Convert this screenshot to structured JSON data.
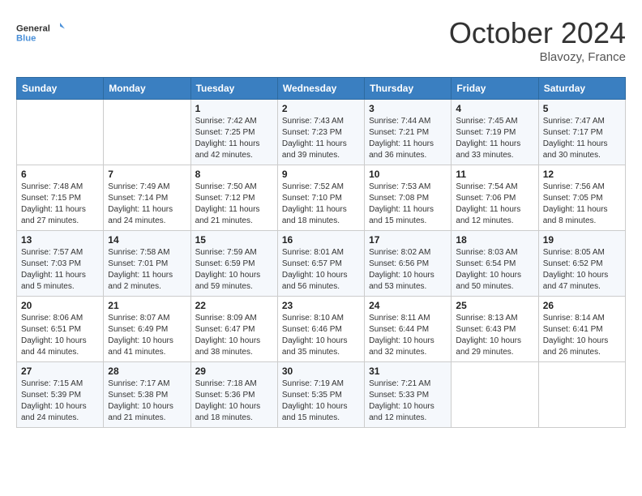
{
  "header": {
    "logo_line1": "General",
    "logo_line2": "Blue",
    "month": "October 2024",
    "location": "Blavozy, France"
  },
  "weekdays": [
    "Sunday",
    "Monday",
    "Tuesday",
    "Wednesday",
    "Thursday",
    "Friday",
    "Saturday"
  ],
  "weeks": [
    [
      {
        "day": "",
        "sunrise": "",
        "sunset": "",
        "daylight": ""
      },
      {
        "day": "",
        "sunrise": "",
        "sunset": "",
        "daylight": ""
      },
      {
        "day": "1",
        "sunrise": "Sunrise: 7:42 AM",
        "sunset": "Sunset: 7:25 PM",
        "daylight": "Daylight: 11 hours and 42 minutes."
      },
      {
        "day": "2",
        "sunrise": "Sunrise: 7:43 AM",
        "sunset": "Sunset: 7:23 PM",
        "daylight": "Daylight: 11 hours and 39 minutes."
      },
      {
        "day": "3",
        "sunrise": "Sunrise: 7:44 AM",
        "sunset": "Sunset: 7:21 PM",
        "daylight": "Daylight: 11 hours and 36 minutes."
      },
      {
        "day": "4",
        "sunrise": "Sunrise: 7:45 AM",
        "sunset": "Sunset: 7:19 PM",
        "daylight": "Daylight: 11 hours and 33 minutes."
      },
      {
        "day": "5",
        "sunrise": "Sunrise: 7:47 AM",
        "sunset": "Sunset: 7:17 PM",
        "daylight": "Daylight: 11 hours and 30 minutes."
      }
    ],
    [
      {
        "day": "6",
        "sunrise": "Sunrise: 7:48 AM",
        "sunset": "Sunset: 7:15 PM",
        "daylight": "Daylight: 11 hours and 27 minutes."
      },
      {
        "day": "7",
        "sunrise": "Sunrise: 7:49 AM",
        "sunset": "Sunset: 7:14 PM",
        "daylight": "Daylight: 11 hours and 24 minutes."
      },
      {
        "day": "8",
        "sunrise": "Sunrise: 7:50 AM",
        "sunset": "Sunset: 7:12 PM",
        "daylight": "Daylight: 11 hours and 21 minutes."
      },
      {
        "day": "9",
        "sunrise": "Sunrise: 7:52 AM",
        "sunset": "Sunset: 7:10 PM",
        "daylight": "Daylight: 11 hours and 18 minutes."
      },
      {
        "day": "10",
        "sunrise": "Sunrise: 7:53 AM",
        "sunset": "Sunset: 7:08 PM",
        "daylight": "Daylight: 11 hours and 15 minutes."
      },
      {
        "day": "11",
        "sunrise": "Sunrise: 7:54 AM",
        "sunset": "Sunset: 7:06 PM",
        "daylight": "Daylight: 11 hours and 12 minutes."
      },
      {
        "day": "12",
        "sunrise": "Sunrise: 7:56 AM",
        "sunset": "Sunset: 7:05 PM",
        "daylight": "Daylight: 11 hours and 8 minutes."
      }
    ],
    [
      {
        "day": "13",
        "sunrise": "Sunrise: 7:57 AM",
        "sunset": "Sunset: 7:03 PM",
        "daylight": "Daylight: 11 hours and 5 minutes."
      },
      {
        "day": "14",
        "sunrise": "Sunrise: 7:58 AM",
        "sunset": "Sunset: 7:01 PM",
        "daylight": "Daylight: 11 hours and 2 minutes."
      },
      {
        "day": "15",
        "sunrise": "Sunrise: 7:59 AM",
        "sunset": "Sunset: 6:59 PM",
        "daylight": "Daylight: 10 hours and 59 minutes."
      },
      {
        "day": "16",
        "sunrise": "Sunrise: 8:01 AM",
        "sunset": "Sunset: 6:57 PM",
        "daylight": "Daylight: 10 hours and 56 minutes."
      },
      {
        "day": "17",
        "sunrise": "Sunrise: 8:02 AM",
        "sunset": "Sunset: 6:56 PM",
        "daylight": "Daylight: 10 hours and 53 minutes."
      },
      {
        "day": "18",
        "sunrise": "Sunrise: 8:03 AM",
        "sunset": "Sunset: 6:54 PM",
        "daylight": "Daylight: 10 hours and 50 minutes."
      },
      {
        "day": "19",
        "sunrise": "Sunrise: 8:05 AM",
        "sunset": "Sunset: 6:52 PM",
        "daylight": "Daylight: 10 hours and 47 minutes."
      }
    ],
    [
      {
        "day": "20",
        "sunrise": "Sunrise: 8:06 AM",
        "sunset": "Sunset: 6:51 PM",
        "daylight": "Daylight: 10 hours and 44 minutes."
      },
      {
        "day": "21",
        "sunrise": "Sunrise: 8:07 AM",
        "sunset": "Sunset: 6:49 PM",
        "daylight": "Daylight: 10 hours and 41 minutes."
      },
      {
        "day": "22",
        "sunrise": "Sunrise: 8:09 AM",
        "sunset": "Sunset: 6:47 PM",
        "daylight": "Daylight: 10 hours and 38 minutes."
      },
      {
        "day": "23",
        "sunrise": "Sunrise: 8:10 AM",
        "sunset": "Sunset: 6:46 PM",
        "daylight": "Daylight: 10 hours and 35 minutes."
      },
      {
        "day": "24",
        "sunrise": "Sunrise: 8:11 AM",
        "sunset": "Sunset: 6:44 PM",
        "daylight": "Daylight: 10 hours and 32 minutes."
      },
      {
        "day": "25",
        "sunrise": "Sunrise: 8:13 AM",
        "sunset": "Sunset: 6:43 PM",
        "daylight": "Daylight: 10 hours and 29 minutes."
      },
      {
        "day": "26",
        "sunrise": "Sunrise: 8:14 AM",
        "sunset": "Sunset: 6:41 PM",
        "daylight": "Daylight: 10 hours and 26 minutes."
      }
    ],
    [
      {
        "day": "27",
        "sunrise": "Sunrise: 7:15 AM",
        "sunset": "Sunset: 5:39 PM",
        "daylight": "Daylight: 10 hours and 24 minutes."
      },
      {
        "day": "28",
        "sunrise": "Sunrise: 7:17 AM",
        "sunset": "Sunset: 5:38 PM",
        "daylight": "Daylight: 10 hours and 21 minutes."
      },
      {
        "day": "29",
        "sunrise": "Sunrise: 7:18 AM",
        "sunset": "Sunset: 5:36 PM",
        "daylight": "Daylight: 10 hours and 18 minutes."
      },
      {
        "day": "30",
        "sunrise": "Sunrise: 7:19 AM",
        "sunset": "Sunset: 5:35 PM",
        "daylight": "Daylight: 10 hours and 15 minutes."
      },
      {
        "day": "31",
        "sunrise": "Sunrise: 7:21 AM",
        "sunset": "Sunset: 5:33 PM",
        "daylight": "Daylight: 10 hours and 12 minutes."
      },
      {
        "day": "",
        "sunrise": "",
        "sunset": "",
        "daylight": ""
      },
      {
        "day": "",
        "sunrise": "",
        "sunset": "",
        "daylight": ""
      }
    ]
  ]
}
